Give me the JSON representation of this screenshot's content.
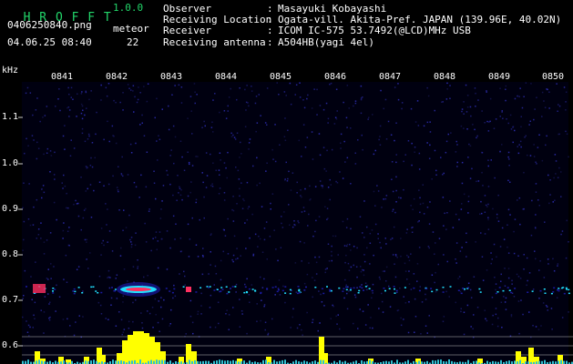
{
  "app": {
    "name": "H R O F F T",
    "version": "1.0.0",
    "filename": "0406250840.png",
    "datetime": "04.06.25 08:40",
    "meteor_label": "meteor",
    "meteor_count": "22"
  },
  "info": [
    {
      "key": "Observer",
      "value": "Masayuki Kobayashi"
    },
    {
      "key": "Receiving Location",
      "value": "Ogata-vill. Akita-Pref. JAPAN (139.96E, 40.02N)"
    },
    {
      "key": "Receiver",
      "value": "ICOM IC-575 53.7492(@LCD)MHz USB"
    },
    {
      "key": "Receiving antenna",
      "value": "A504HB(yagi 4el)"
    }
  ],
  "spectrogram": {
    "freq_unit": "kHz",
    "freq_ticks": [
      "1.1",
      "1.0",
      "0.9",
      "0.8",
      "0.7",
      "0.6"
    ],
    "time_ticks": [
      "0841",
      "0842",
      "0843",
      "0844",
      "0845",
      "0846",
      "0847",
      "0848",
      "0849",
      "0850"
    ],
    "colors": {
      "background": "#000010",
      "noise": "#1a1aa0",
      "echo_hot": "#ff3060",
      "echo_mid": "#20e0ff",
      "meter": "#ffff00"
    }
  }
}
